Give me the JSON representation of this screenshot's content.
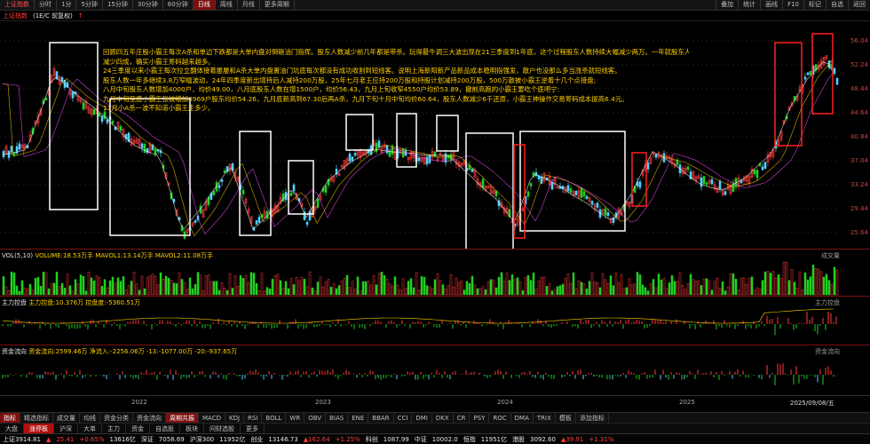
{
  "toolbar": {
    "stock_name": "上证指数",
    "periods": [
      {
        "label": "分时",
        "active": false
      },
      {
        "label": "1分",
        "active": false
      },
      {
        "label": "5分钟",
        "active": false
      },
      {
        "label": "15分钟",
        "active": false
      },
      {
        "label": "30分钟",
        "active": false
      },
      {
        "label": "60分钟",
        "active": false
      },
      {
        "label": "日线",
        "active": true
      },
      {
        "label": "周线",
        "active": false
      },
      {
        "label": "月线",
        "active": false
      },
      {
        "label": "更多周期",
        "active": false
      }
    ],
    "right_items": [
      "叠加",
      "统计",
      "画线",
      "F10",
      "标记",
      "自选",
      "返回"
    ]
  },
  "ticker": {
    "name": "上证指数",
    "items": [
      "(1E/C 前复权)",
      "↑"
    ]
  },
  "main_chart": {
    "right_axis": [
      "56.04",
      "52.24",
      "48.44",
      "44.64",
      "40.84",
      "37.04",
      "33.24",
      "29.44",
      "25.64"
    ]
  },
  "annotations": [
    "回顾四五年庄股小霸王每次A杀和单边下跌都是大单内盘对倒砸油门指挥。股东人数减少前几年都是带杀。玩得最牛调三大波出现在21三季度到1年底，这个过程股东人数持续大幅减少两万。一年就股东人数",
    "减少四成，确实小霸王筹码越来越多。",
    "24三季度以来小霸王每次拉立翻体接着屡屡和A杀大单内盘置油门坑底每次都没有成功收割到短线客。说明上海新阳新产品新品成本稳明指强发，散户也没那么多当涨杀就短线客。",
    "股东人数一年多继续3.8万窄幅波动，24年四季度新出增持后人减持200万股，25年七月老王应持200万股和持股计划减持200万股，500万散被小霸王逆着十几个点接盘;",
    "八月中旬股东人数增加4000户，均价49.00，八月底股东人数在增1500户，均价56.43，九月上旬收窄4550户均价53.89，撤前高跑的小霸王要吃个底吧宁:",
    "九月中旬至底小霸王张被增加8969户股东均价54.26，九月底新高到67.30后再A杀，九月下旬十月中旬均价60.64，股东人数减少6千还原，小霸王神操作交易筹码成本提高6.4元。",
    "11月小A杀一波不知道小霸王走多少。"
  ],
  "volume_panel": {
    "title": "VOL(5,10)",
    "values": "VOLUME:18.53万手  MAVOL1:13.14万手  MAVOL2:11.08万手",
    "right_label": "成交量"
  },
  "macd_panel": {
    "title": "主力控盘",
    "values": "主力控盘:10.376万  控盘度:-5360.51万",
    "right_label": "主力控盘"
  },
  "fund_panel": {
    "title": "资金流向",
    "values": "资金流向:2599.46万  净流入:-2256.06万  -13:-1077.00万  -20:-937.65万",
    "right_label": "资金流向"
  },
  "xaxis": {
    "labels": [
      "2022",
      "2023",
      "2024",
      "2025"
    ],
    "right_date": "2025/09/08/五"
  },
  "indicator_tabs": [
    {
      "label": "指标",
      "active": true
    },
    {
      "label": "精选指标",
      "active": false
    },
    {
      "label": "成交量",
      "active": false
    },
    {
      "label": "均线",
      "active": false
    },
    {
      "label": "资金分类",
      "active": false
    },
    {
      "label": "资金流向",
      "active": false
    },
    {
      "label": "周期共振",
      "active": true
    },
    {
      "label": "MACD",
      "active": false
    },
    {
      "label": "KDJ",
      "active": false
    },
    {
      "label": "RSI",
      "active": false
    },
    {
      "label": "BOLL",
      "active": false
    },
    {
      "label": "WR",
      "active": false
    },
    {
      "label": "OBV",
      "active": false
    },
    {
      "label": "BIAS",
      "active": false
    },
    {
      "label": "ENE",
      "active": false
    },
    {
      "label": "BBAR",
      "active": false
    },
    {
      "label": "CCI",
      "active": false
    },
    {
      "label": "DMI",
      "active": false
    },
    {
      "label": "DKX",
      "active": false
    },
    {
      "label": "CR",
      "active": false
    },
    {
      "label": "PSY",
      "active": false
    },
    {
      "label": "ROC",
      "active": false
    },
    {
      "label": "DMA",
      "active": false
    },
    {
      "label": "TRIX",
      "active": false
    },
    {
      "label": "模板",
      "active": false
    },
    {
      "label": "添加指标",
      "active": false
    }
  ],
  "nav_tabs": [
    {
      "label": "大盘",
      "active": false
    },
    {
      "label": "涨停板",
      "active": true
    },
    {
      "label": "沪深",
      "active": false
    },
    {
      "label": "大单",
      "active": false
    },
    {
      "label": "主力",
      "active": false
    },
    {
      "label": "资金",
      "active": false
    },
    {
      "label": "自选股",
      "active": false
    },
    {
      "label": "板块",
      "active": false
    },
    {
      "label": "问财选股",
      "active": false
    },
    {
      "label": "更多",
      "active": false
    }
  ],
  "status_bar": [
    {
      "text": "上证3914.81",
      "cls": "wh"
    },
    {
      "text": "▲",
      "cls": "up"
    },
    {
      "text": "25.41",
      "cls": "up"
    },
    {
      "text": "+0.65%",
      "cls": "up"
    },
    {
      "text": "13616亿",
      "cls": "wh"
    },
    {
      "text": "深证",
      "cls": "wh"
    },
    {
      "text": "7058.69",
      "cls": "wh"
    },
    {
      "text": "沪深300",
      "cls": "wh"
    },
    {
      "text": "11952亿",
      "cls": "wh"
    },
    {
      "text": "创业",
      "cls": "wh"
    },
    {
      "text": "13146.73",
      "cls": "wh"
    },
    {
      "text": "▲162.64",
      "cls": "up"
    },
    {
      "text": "+1.25%",
      "cls": "up"
    },
    {
      "text": "科创",
      "cls": "wh"
    },
    {
      "text": "1087.99",
      "cls": "wh"
    },
    {
      "text": "中证",
      "cls": "wh"
    },
    {
      "text": "10002.0",
      "cls": "wh"
    },
    {
      "text": "恒指",
      "cls": "wh"
    },
    {
      "text": "11951亿",
      "cls": "wh"
    },
    {
      "text": "港股",
      "cls": "wh"
    },
    {
      "text": "3092.60",
      "cls": "wh"
    },
    {
      "text": "▲39.91",
      "cls": "up"
    },
    {
      "text": "+1.31%",
      "cls": "up"
    }
  ],
  "colors": {
    "up": "#ff3b3b",
    "down": "#20d020",
    "box": "#ffffff",
    "redbox": "#ff2020",
    "annotation": "#ffcf00",
    "panel_border": "#7a1010"
  }
}
